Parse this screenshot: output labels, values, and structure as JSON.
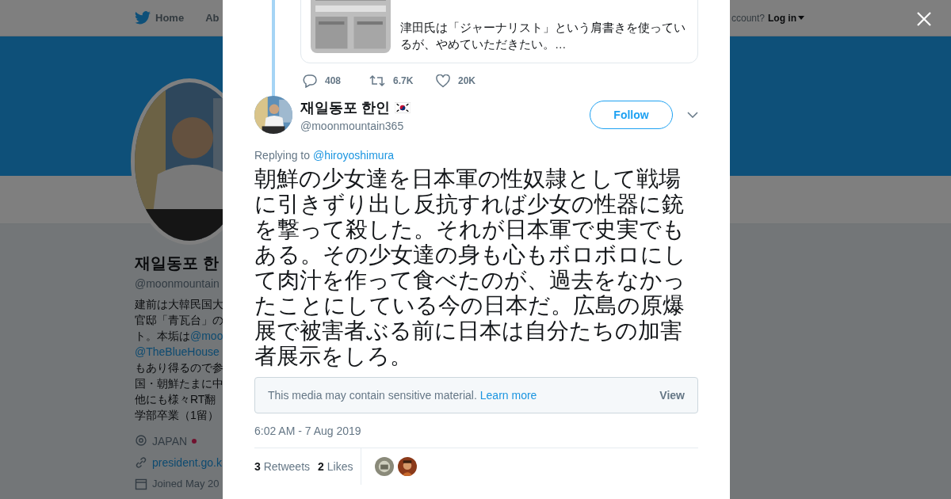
{
  "nav": {
    "items": [
      {
        "label": "Home",
        "kind": "home"
      },
      {
        "label": "Ab",
        "kind": "plain"
      }
    ],
    "login_prompt": "ccount?",
    "login": "Log in"
  },
  "profile": {
    "name": "재일동포 한",
    "handle": "@moonmountain",
    "bio": [
      {
        "text": "建前は大韓民国大"
      },
      {
        "text": "官邸「青瓦台」の"
      },
      {
        "text": "ト。本垢は",
        "link": "@moo"
      },
      {
        "link": "@TheBlueHouse"
      },
      {
        "text": "もあり得るので参"
      },
      {
        "text": "国・朝鮮たまに中"
      },
      {
        "text": "他にも様々RT翻"
      },
      {
        "text": "学部卒業（1留）"
      }
    ],
    "location": "JAPAN",
    "website": "president.go.k",
    "joined": "Joined May 20"
  },
  "quoted": {
    "text": "津田氏は「ジャーナリスト」という肩書きを使っているが、やめていただきたい。…",
    "actions": [
      {
        "kind": "reply",
        "count": "408"
      },
      {
        "kind": "retweet",
        "count": "6.7K"
      },
      {
        "kind": "like",
        "count": "20K"
      }
    ]
  },
  "tweet": {
    "name": "재일동포 한인",
    "handle": "@moonmountain365",
    "follow": "Follow",
    "replying_to": "Replying to",
    "reply_handle": "@hiroyoshimura",
    "text": "朝鮮の少女達を日本軍の性奴隷として戦場に引きずり出し反抗すれば少女の性器に銃を撃って殺した。それが日本軍で史実でもある。その少女達の身も心もボロボロにして肉汁を作って食べたのが、過去をなかったことにしている今の日本だ。広島の原爆展で被害者ぶる前に日本は自分たちの加害者展示をしろ。",
    "sensitive": {
      "text": "This media may contain sensitive material.",
      "link": "Learn more",
      "action": "View"
    },
    "timestamp": "6:02 AM - 7 Aug 2019",
    "stats": [
      {
        "count": "3",
        "label": "Retweets"
      },
      {
        "count": "2",
        "label": "Likes"
      }
    ]
  }
}
